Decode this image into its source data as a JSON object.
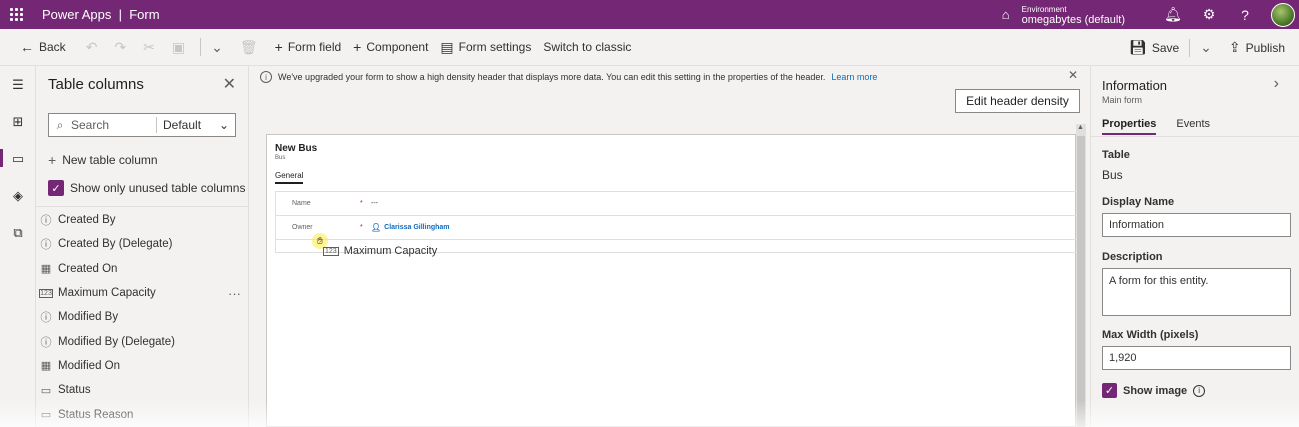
{
  "topbar": {
    "app_title": "Power Apps  |  Form",
    "environment_label": "Environment",
    "environment_name": "omegabytes (default)",
    "icons": [
      "waffle-icon",
      "environment-icon",
      "bell-icon",
      "gear-icon",
      "help-icon"
    ]
  },
  "commandbar": {
    "back": "Back",
    "form_field": "Form field",
    "component": "Component",
    "form_settings": "Form settings",
    "switch_classic": "Switch to classic",
    "save": "Save",
    "publish": "Publish"
  },
  "left_panel": {
    "title": "Table columns",
    "search_placeholder": "Search",
    "filter_value": "Default",
    "new_column": "New table column",
    "show_unused": "Show only unused table columns",
    "columns": [
      {
        "label": "Created By",
        "icon": "lookup-icon"
      },
      {
        "label": "Created By (Delegate)",
        "icon": "lookup-icon"
      },
      {
        "label": "Created On",
        "icon": "date-icon"
      },
      {
        "label": "Maximum Capacity",
        "icon": "number-icon"
      },
      {
        "label": "Modified By",
        "icon": "lookup-icon"
      },
      {
        "label": "Modified By (Delegate)",
        "icon": "lookup-icon"
      },
      {
        "label": "Modified On",
        "icon": "date-icon"
      },
      {
        "label": "Status",
        "icon": "option-icon"
      },
      {
        "label": "Status Reason",
        "icon": "option-icon"
      }
    ],
    "more_symbol": "···"
  },
  "banner": {
    "text": "We've upgraded your form to show a high density header that displays more data. You can edit this setting in the properties of the header.",
    "link": "Learn more",
    "button": "Edit header density"
  },
  "form": {
    "title": "New Bus",
    "entity": "Bus",
    "tab": "General",
    "fields": [
      {
        "label": "Name",
        "required": "*",
        "value": "---"
      },
      {
        "label": "Owner",
        "required": "*",
        "value": "Clarissa Gillingham"
      }
    ],
    "drag_label": "Maximum Capacity",
    "drag_icon_text": "123"
  },
  "right_panel": {
    "title": "Information",
    "subtitle": "Main form",
    "tabs": [
      "Properties",
      "Events"
    ],
    "table_label": "Table",
    "table_value": "Bus",
    "display_name_label": "Display Name",
    "display_name_value": "Information",
    "description_label": "Description",
    "description_value": "A form for this entity.",
    "max_width_label": "Max Width (pixels)",
    "max_width_value": "1,920",
    "show_image_label": "Show image"
  },
  "colors": {
    "brand": "#742774",
    "link": "#0f6cbd"
  }
}
